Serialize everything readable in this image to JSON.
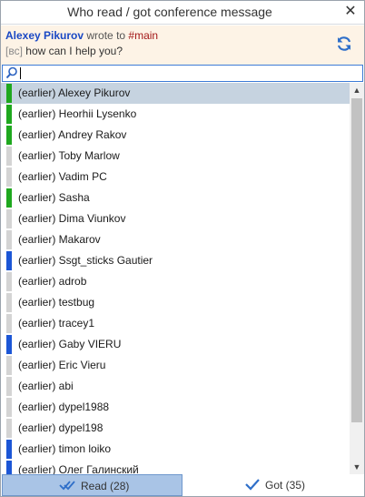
{
  "window": {
    "title": "Who read / got conference message",
    "close_icon": "close-icon"
  },
  "message": {
    "sender": "Alexey Pikurov",
    "wrote": "wrote to",
    "channel": "#main",
    "tag": "[вс]",
    "text": "how can I help you?",
    "refresh_icon": "refresh-icon"
  },
  "search": {
    "value": "",
    "placeholder": "",
    "icon": "search-icon"
  },
  "colors": {
    "online": "#1fa81f",
    "offline": "#d4d4d4",
    "away": "#1c56d6",
    "selected": "#c6d3e0",
    "accent": "#3d7bd6"
  },
  "list": {
    "items": [
      {
        "label": "(earlier) Alexey Pikurov",
        "status": "online",
        "selected": true
      },
      {
        "label": "(earlier) Heorhii Lysenko",
        "status": "online",
        "selected": false
      },
      {
        "label": "(earlier) Andrey Rakov",
        "status": "online",
        "selected": false
      },
      {
        "label": "(earlier) Toby Marlow",
        "status": "offline",
        "selected": false
      },
      {
        "label": "(earlier) Vadim PC",
        "status": "offline",
        "selected": false
      },
      {
        "label": "(earlier) Sasha",
        "status": "online",
        "selected": false
      },
      {
        "label": "(earlier) Dima Viunkov",
        "status": "offline",
        "selected": false
      },
      {
        "label": "(earlier) Makarov",
        "status": "offline",
        "selected": false
      },
      {
        "label": "(earlier) Ssgt_sticks Gautier",
        "status": "away",
        "selected": false
      },
      {
        "label": "(earlier) adrob",
        "status": "offline",
        "selected": false
      },
      {
        "label": "(earlier) testbug",
        "status": "offline",
        "selected": false
      },
      {
        "label": "(earlier) tracey1",
        "status": "offline",
        "selected": false
      },
      {
        "label": "(earlier) Gaby VIERU",
        "status": "away",
        "selected": false
      },
      {
        "label": "(earlier) Eric Vieru",
        "status": "offline",
        "selected": false
      },
      {
        "label": "(earlier) abi",
        "status": "offline",
        "selected": false
      },
      {
        "label": "(earlier) dypel1988",
        "status": "offline",
        "selected": false
      },
      {
        "label": "(earlier) dypel198",
        "status": "offline",
        "selected": false
      },
      {
        "label": "(earlier) timon loiko",
        "status": "away",
        "selected": false
      },
      {
        "label": "(earlier) Олег Галинский",
        "status": "away",
        "selected": false
      }
    ]
  },
  "scroll": {
    "position": 0
  },
  "tabs": {
    "read": {
      "label": "Read (28)",
      "active": true
    },
    "got": {
      "label": "Got (35)",
      "active": false
    }
  }
}
